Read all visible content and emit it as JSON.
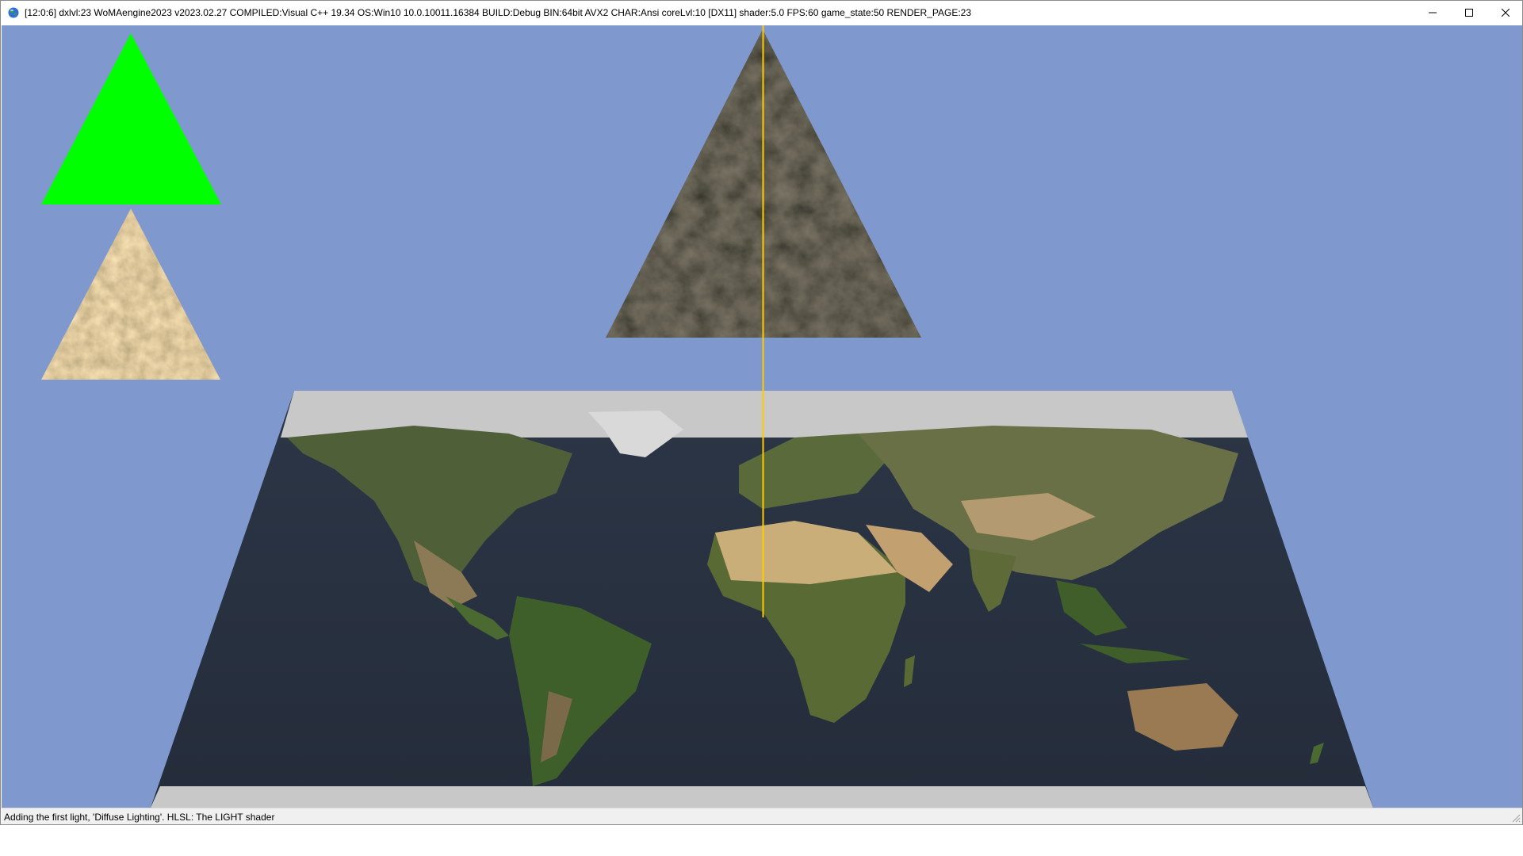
{
  "window": {
    "title": "[12:0:6] dxlvl:23 WoMAengine2023 v2023.02.27 COMPILED:Visual C++ 19.34 OS:Win10 10.0.10011.16384 BUILD:Debug BIN:64bit AVX2 CHAR:Ansi coreLvl:10 [DX11] shader:5.0 FPS:60 game_state:50 RENDER_PAGE:23",
    "app_icon": "globe-icon",
    "controls": {
      "minimize": "minimize-icon",
      "maximize": "maximize-icon",
      "close": "close-icon"
    }
  },
  "scene": {
    "background_color": "#7f99cf",
    "objects": [
      {
        "name": "green-triangle",
        "fill": "#00ff00"
      },
      {
        "name": "sand-textured-triangle",
        "texture": "sand"
      },
      {
        "name": "dark-textured-triangle",
        "texture": "dark-rock"
      },
      {
        "name": "world-map-plane",
        "texture": "earth-satellite-map"
      },
      {
        "name": "light-ray-line",
        "color": "#ffcc00"
      }
    ]
  },
  "statusbar": {
    "text": "Adding the first light, 'Diffuse Lighting'. HLSL: The LIGHT shader"
  }
}
